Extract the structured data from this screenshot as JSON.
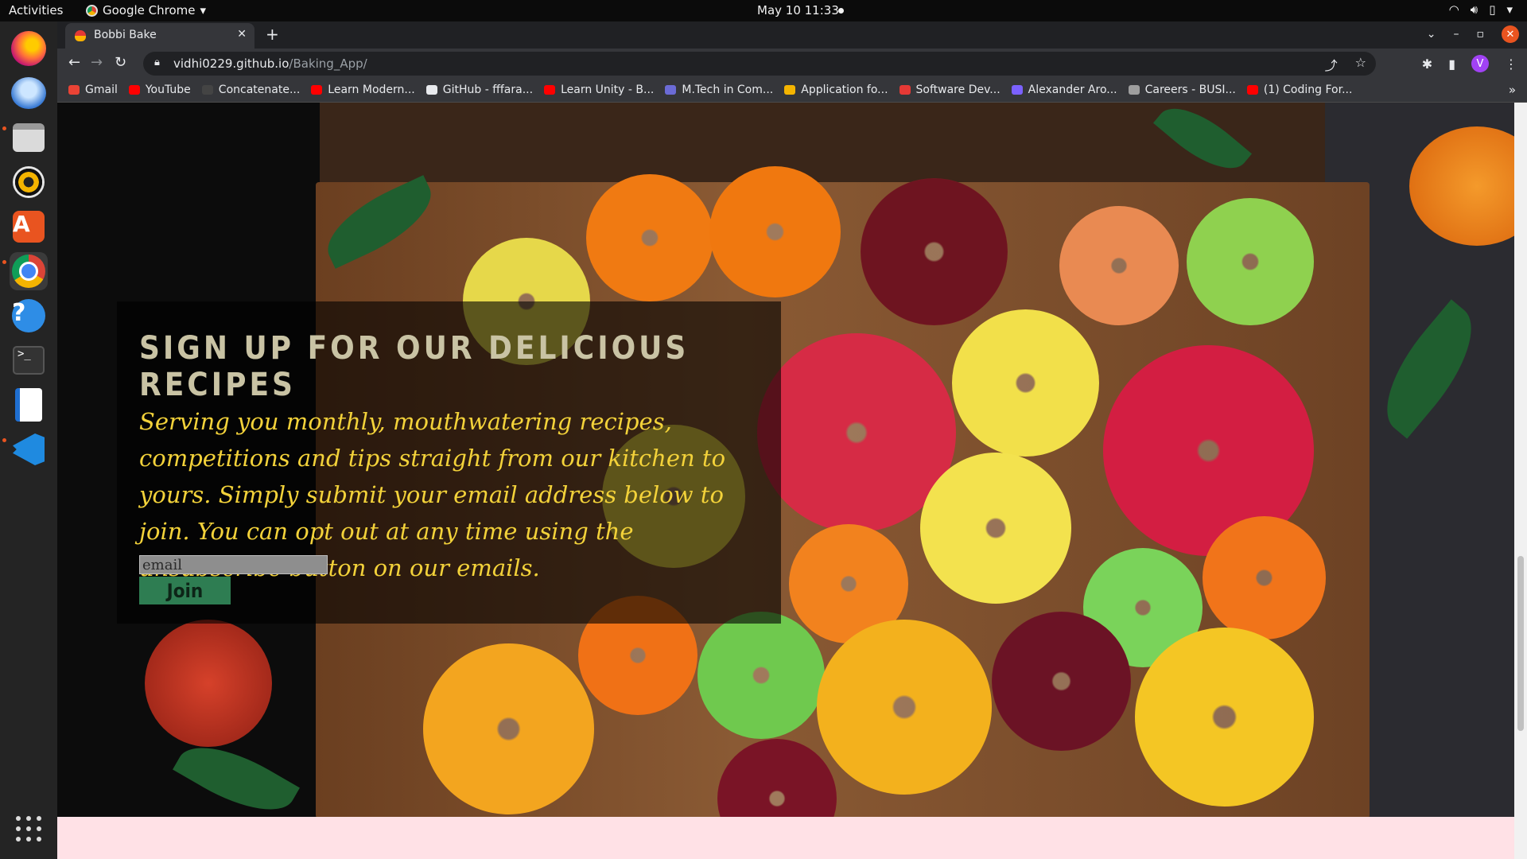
{
  "topbar": {
    "activities": "Activities",
    "app_name": "Google Chrome",
    "clock": "May 10  11:33"
  },
  "browser": {
    "tab_title": "Bobbi Bake",
    "url_host": "vidhi0229.github.io",
    "url_path": "/Baking_App/",
    "avatar_letter": "V",
    "bookmarks": [
      {
        "label": "Gmail",
        "color": "#ea4335"
      },
      {
        "label": "YouTube",
        "color": "#ff0000"
      },
      {
        "label": "Concatenate...",
        "color": "#444444"
      },
      {
        "label": "Learn Modern...",
        "color": "#ff0000"
      },
      {
        "label": "GitHub - fffara...",
        "color": "#e8eaed"
      },
      {
        "label": "Learn Unity - B...",
        "color": "#ff0000"
      },
      {
        "label": "M.Tech in Com...",
        "color": "#6b6bd6"
      },
      {
        "label": "Application fo...",
        "color": "#f4b400"
      },
      {
        "label": "Software Dev...",
        "color": "#e53935"
      },
      {
        "label": "Alexander Aro...",
        "color": "#7b61ff"
      },
      {
        "label": "Careers - BUSI...",
        "color": "#9e9e9e"
      },
      {
        "label": "(1) Coding For...",
        "color": "#ff0000"
      }
    ]
  },
  "signup": {
    "heading": "Sign up for our Delicious Recipes",
    "body": "Serving you monthly, mouthwatering recipes, competitions and tips straight from our kitchen to yours. Simply submit your email address below to join. You can opt out at any time using the unsubscribe button on our emails.",
    "email_placeholder": "email",
    "join_label": "Join"
  },
  "colors": {
    "heading": "#c9c3a4",
    "body_text": "#f3d23a",
    "join_button": "#2e7d52",
    "footer_strip": "#ffe1e6",
    "accent": "#e95420"
  }
}
